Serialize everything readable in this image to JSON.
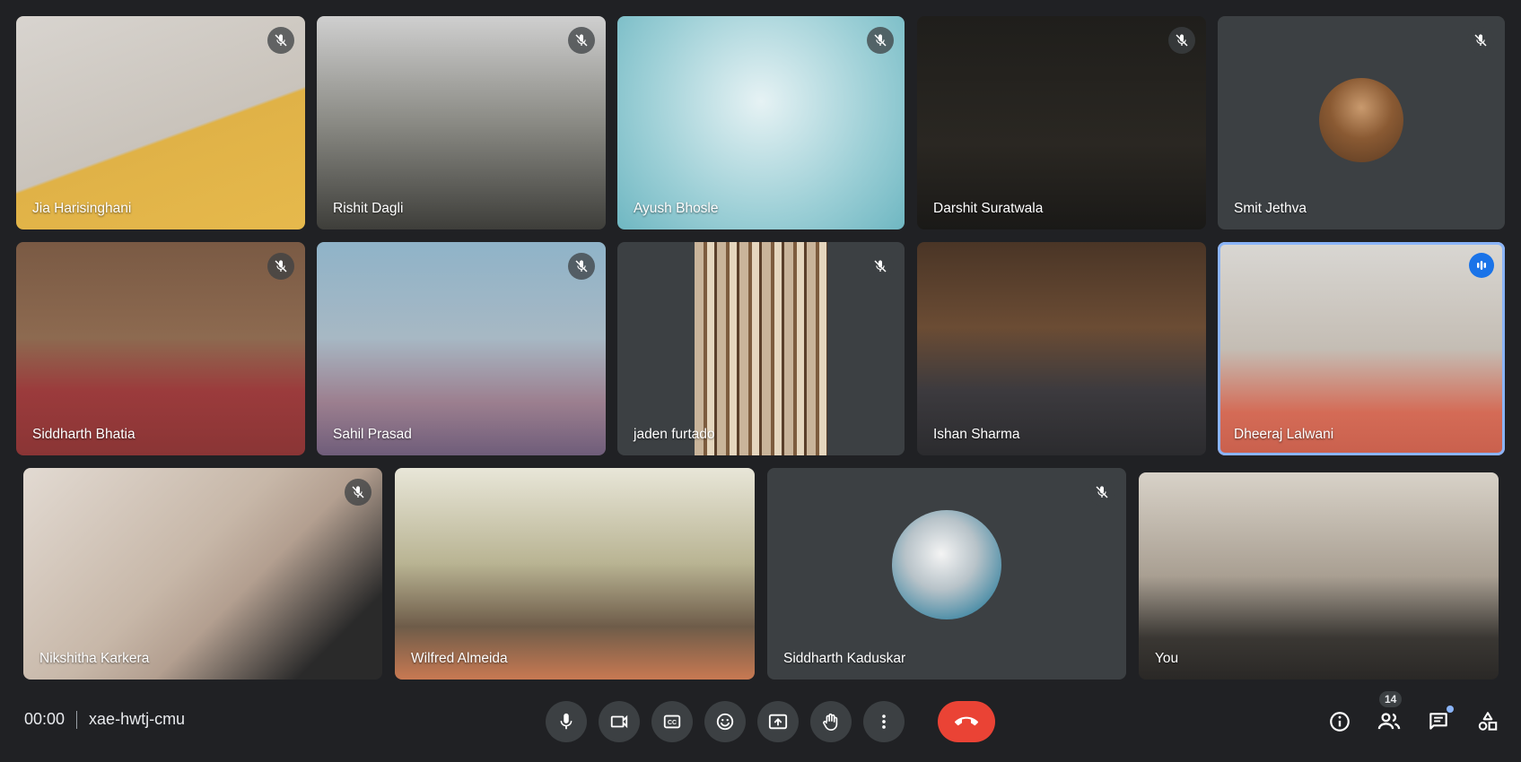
{
  "participants": [
    {
      "name": "Jia Harisinghani"
    },
    {
      "name": "Rishit Dagli"
    },
    {
      "name": "Ayush Bhosle"
    },
    {
      "name": "Darshit Suratwala"
    },
    {
      "name": "Smit Jethva"
    },
    {
      "name": "Siddharth Bhatia"
    },
    {
      "name": "Sahil Prasad"
    },
    {
      "name": "jaden furtado"
    },
    {
      "name": "Ishan Sharma"
    },
    {
      "name": "Dheeraj Lalwani"
    },
    {
      "name": "Nikshitha Karkera"
    },
    {
      "name": "Wilfred Almeida"
    },
    {
      "name": "Siddharth Kaduskar"
    },
    {
      "name": "You"
    }
  ],
  "meeting": {
    "time": "00:00",
    "code": "xae-hwtj-cmu"
  },
  "controls": {
    "participants_count": "14"
  },
  "colors": {
    "background": "#202124",
    "tile": "#3c4043",
    "end_call": "#ea4335",
    "active_speaker": "#8ab4f8",
    "speaking_indicator": "#1a73e8"
  }
}
